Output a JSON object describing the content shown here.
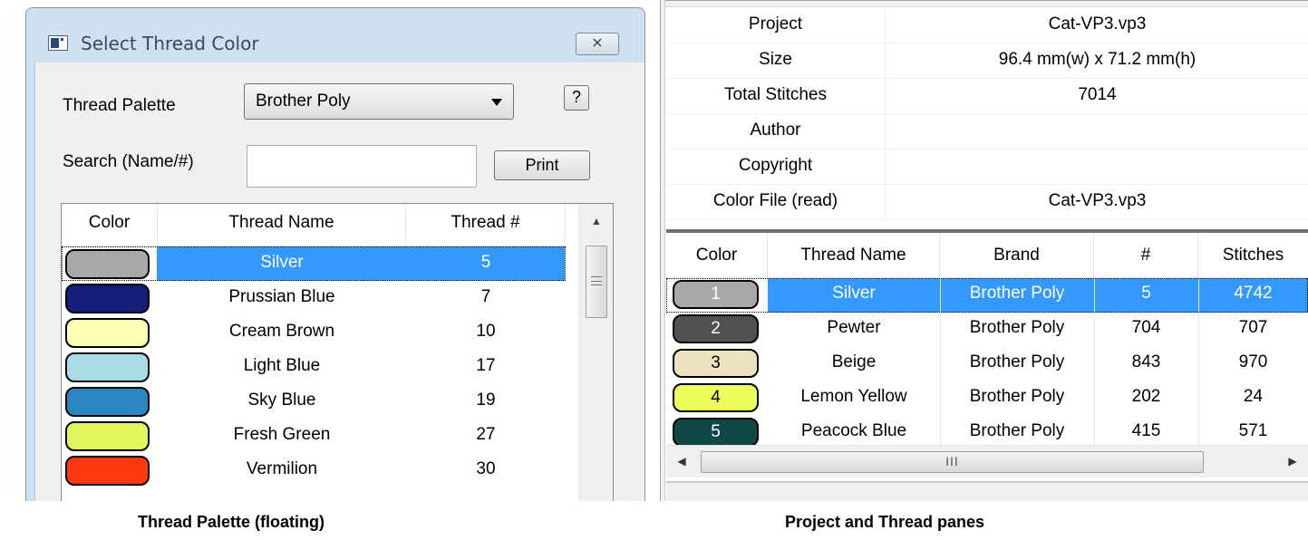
{
  "dialog": {
    "title": "Select Thread Color",
    "close_label": "⨯",
    "palette_label": "Thread Palette",
    "palette_value": "Brother Poly",
    "help_label": "?",
    "search_label": "Search (Name/#)",
    "search_value": "",
    "print_label": "Print",
    "columns": [
      "Color",
      "Thread Name",
      "Thread #"
    ],
    "threads": [
      {
        "name": "Silver",
        "number": "5",
        "color": "#a8a8a8"
      },
      {
        "name": "Prussian Blue",
        "number": "7",
        "color": "#151e78"
      },
      {
        "name": "Cream Brown",
        "number": "10",
        "color": "#ffffb4"
      },
      {
        "name": "Light Blue",
        "number": "17",
        "color": "#a8dce6"
      },
      {
        "name": "Sky Blue",
        "number": "19",
        "color": "#2a86c0"
      },
      {
        "name": "Fresh Green",
        "number": "27",
        "color": "#e2f55a"
      },
      {
        "name": "Vermilion",
        "number": "30",
        "color": "#ff3a10"
      }
    ],
    "selected_index": 0
  },
  "project": {
    "rows": [
      {
        "key": "Project",
        "value": "Cat-VP3.vp3"
      },
      {
        "key": "Size",
        "value": "96.4 mm(w) x 71.2 mm(h)"
      },
      {
        "key": "Total Stitches",
        "value": "7014"
      },
      {
        "key": "Author",
        "value": ""
      },
      {
        "key": "Copyright",
        "value": ""
      },
      {
        "key": "Color File (read)",
        "value": "Cat-VP3.vp3"
      }
    ]
  },
  "thread_pane": {
    "columns": [
      "Color",
      "Thread Name",
      "Brand",
      "#",
      "Stitches"
    ],
    "rows": [
      {
        "index": "1",
        "name": "Silver",
        "brand": "Brother Poly",
        "number": "5",
        "stitches": "4742",
        "color": "#a8a8a8",
        "text_color": "#ffffff"
      },
      {
        "index": "2",
        "name": "Pewter",
        "brand": "Brother Poly",
        "number": "704",
        "stitches": "707",
        "color": "#4f5152",
        "text_color": "#ffffff"
      },
      {
        "index": "3",
        "name": "Beige",
        "brand": "Brother Poly",
        "number": "843",
        "stitches": "970",
        "color": "#efe2c0",
        "text_color": "#000000"
      },
      {
        "index": "4",
        "name": "Lemon Yellow",
        "brand": "Brother Poly",
        "number": "202",
        "stitches": "24",
        "color": "#eeff5c",
        "text_color": "#000000"
      },
      {
        "index": "5",
        "name": "Peacock Blue",
        "brand": "Brother Poly",
        "number": "415",
        "stitches": "571",
        "color": "#104848",
        "text_color": "#ffffff"
      }
    ],
    "selected_index": 0,
    "hscroll_grip": "III"
  },
  "captions": {
    "left": "Thread Palette (floating)",
    "right": "Project and Thread panes"
  },
  "colors": {
    "selection": "#3399ff",
    "dialog_frame": "#cfe0f1"
  }
}
